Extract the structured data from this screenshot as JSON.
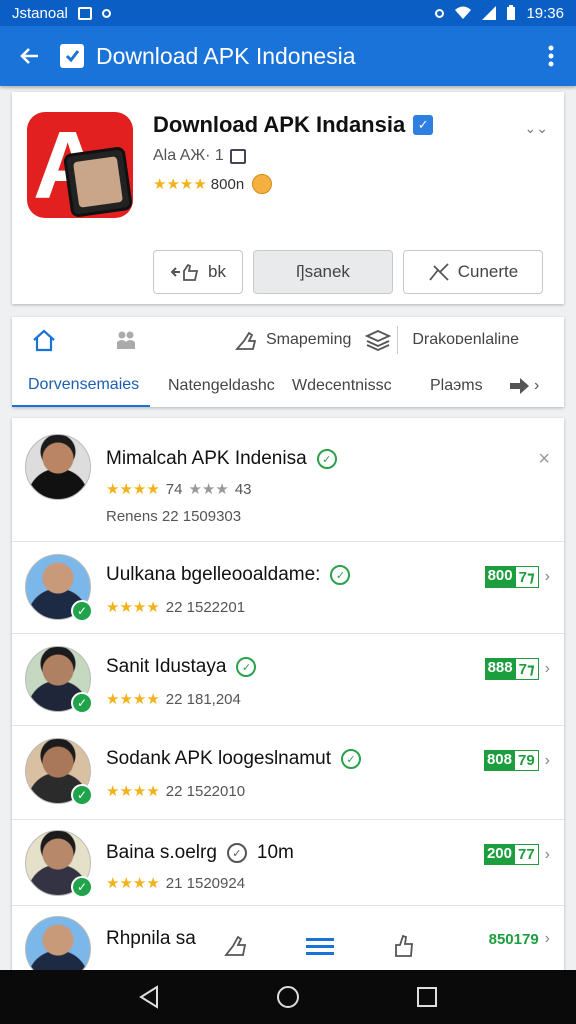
{
  "status_bar": {
    "carrier": "Jstanoal",
    "time": "19:36"
  },
  "app_bar": {
    "title": "Download APK Indonesia"
  },
  "app_header": {
    "name": "Download APK Indansia",
    "sub": "Ala AЖ· 1",
    "rating_stars": "★★★★",
    "rating_text": "800n",
    "buttons": [
      {
        "label": "bk"
      },
      {
        "label": "ſ]sanek"
      },
      {
        "label": "Cunerte"
      }
    ]
  },
  "tabs": {
    "top": [
      {
        "label": "Smapeming"
      },
      {
        "label": "Drakoᴅenlaline"
      }
    ],
    "bottom": [
      {
        "label": "Dorvensemaies"
      },
      {
        "label": "Natengeldashc"
      },
      {
        "label": "Wdecentnissc"
      },
      {
        "label": "Plaэms"
      }
    ]
  },
  "list": [
    {
      "title": "Mimalcah APK Indenisa",
      "stars": "★★★★",
      "rating_a": "74",
      "stars_b": "★★★",
      "rating_b": "43",
      "meta": "Renens 22 1509303"
    },
    {
      "title": "Uulkana bgelleooaldame:",
      "stars": "★★★★",
      "rating": "22 1522201",
      "badge_g": "800",
      "badge_w": "7⁊"
    },
    {
      "title": "Sanit Idustaya",
      "stars": "★★★★",
      "rating": "22 181,204",
      "badge_g": "888",
      "badge_w": "7⁊"
    },
    {
      "title": "Sodank APK loogeslnamut",
      "stars": "★★★★",
      "rating": "22 1522010",
      "badge_g": "808",
      "badge_w": "79"
    },
    {
      "title": "Baina s.oelrg",
      "title_extra": "10m",
      "stars": "★★★★",
      "rating": "21 1520924",
      "badge_g": "200",
      "badge_w": "77"
    },
    {
      "title": "Rhpnila sa",
      "badge_text": "850179"
    }
  ],
  "colors": {
    "primary": "#1a73d9",
    "status": "#0b5fc4",
    "accent_green": "#1c9e3e",
    "star": "#f2b21b",
    "logo_red": "#e1201f"
  }
}
